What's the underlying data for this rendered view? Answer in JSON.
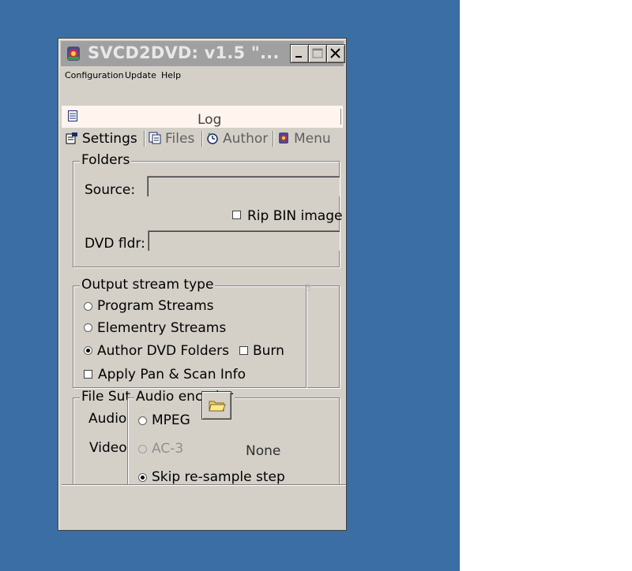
{
  "window": {
    "title": "SVCD2DVD: v1.5 \"..."
  },
  "menu": [
    "Configuration",
    "Update",
    "Help"
  ],
  "log_tab": {
    "label": "Log"
  },
  "tabs": [
    {
      "label": "Settings",
      "icon": "settings-icon",
      "active": true
    },
    {
      "label": "Files",
      "icon": "files-icon",
      "active": false
    },
    {
      "label": "Author",
      "icon": "author-icon",
      "active": false
    },
    {
      "label": "Menu",
      "icon": "menu-icon",
      "active": false
    }
  ],
  "folders": {
    "title": "Folders",
    "source_label": "Source:",
    "source_value": "",
    "rip_bin_label": "Rip BIN image",
    "rip_bin_checked": false,
    "dvd_label": "DVD fldr:",
    "dvd_value": ""
  },
  "output": {
    "title": "Output stream type",
    "hidden_char": "e",
    "options": [
      {
        "label": "Program Streams",
        "selected": false
      },
      {
        "label": "Elementry Streams",
        "selected": false
      },
      {
        "label": "Author DVD Folders",
        "selected": true
      }
    ],
    "burn_label": "Burn",
    "burn_checked": false,
    "pan_scan_label": "Apply Pan & Scan Info",
    "pan_scan_checked": false
  },
  "file_substream": {
    "title": "File Sut",
    "audio_label": "Audio",
    "video_label": "Video"
  },
  "audio_encoder": {
    "title": "Audio encoder",
    "options": [
      {
        "label": "MPEG",
        "selected": false,
        "enabled": true
      },
      {
        "label": "AC-3",
        "selected": false,
        "enabled": false
      },
      {
        "label": "Skip re-sample step",
        "selected": true,
        "enabled": true
      }
    ],
    "none_label": "None"
  },
  "colors": {
    "desktop": "#3a6ea5",
    "window_face": "#d4d0c8",
    "titlebar_inactive": "#a0a0a0",
    "log_strip": "#fff4ee"
  }
}
